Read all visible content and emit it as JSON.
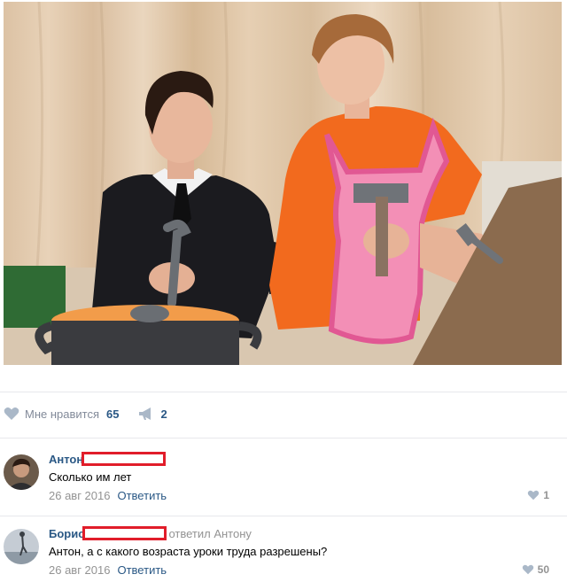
{
  "post": {
    "image_alt": "",
    "likes_label": "Мне нравится",
    "likes_count": "65",
    "reposts_count": "2"
  },
  "comments": [
    {
      "author": "Антон",
      "reply_to": "",
      "text": "Сколько им лет",
      "date": "26 авг 2016",
      "reply_label": "Ответить",
      "likes": "1"
    },
    {
      "author": "Борис",
      "reply_to": "ответил Антону",
      "text": "Антон, а с какого возраста уроки труда разрешены?",
      "date": "26 авг 2016",
      "reply_label": "Ответить",
      "likes": "50"
    }
  ],
  "colors": {
    "link": "#2a5885",
    "muted": "#939393",
    "icon": "#aab8c8",
    "redaction": "#e11d2a"
  }
}
